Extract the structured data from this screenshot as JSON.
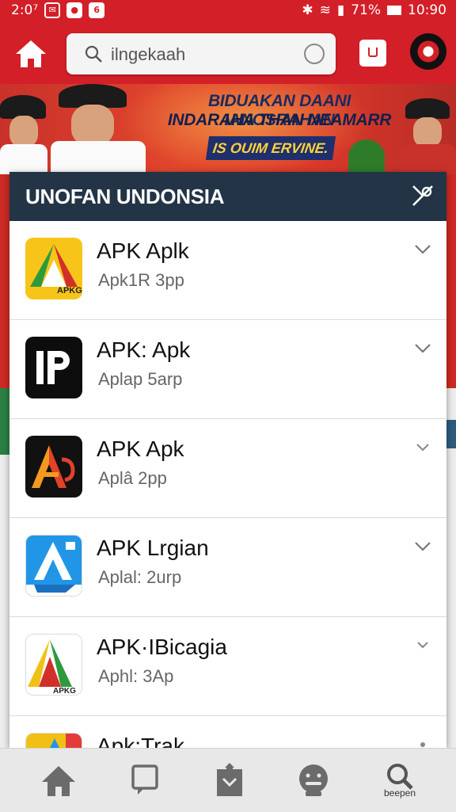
{
  "status_bar": {
    "time_left": "2:0⁷",
    "battery_percent": "71%",
    "time_right": "10:90",
    "accent_color": "#d31f28"
  },
  "app_bar": {
    "search_query": "ilngekaah",
    "home_icon": "home-icon",
    "bookmark_icon": "bookmark-icon",
    "avatar": "profile-avatar"
  },
  "banner": {
    "line1": "BIDUAKAN DAANI IANOSRAHAN",
    "line2": "INDARAHA THAN NEAMARR",
    "tag": "IS OUIM ERVINE."
  },
  "panel": {
    "title": "UNOFAN UNDONSIA",
    "header_color": "#223446",
    "items": [
      {
        "name": "APK Aplk",
        "sub": "Apk1R 3pp",
        "icon": "apk-triangle-green-yellow-icon"
      },
      {
        "name": "APK: Apk",
        "sub": "Aplap 5arp",
        "icon": "ip-black-icon"
      },
      {
        "name": "APK Apk",
        "sub": "Aplâ 2pp",
        "icon": "a-orange-black-icon"
      },
      {
        "name": "APK Lrgian",
        "sub": "Aplal: 2urp",
        "icon": "a-blue-icon"
      },
      {
        "name": "APK·IBicagia",
        "sub": "Aphl: 3Ap",
        "icon": "apkg-triangle-icon"
      },
      {
        "name": "Apk:Trak",
        "sub": "",
        "icon": "a-blue-red-icon"
      }
    ]
  },
  "bottom_nav": {
    "items": [
      "home-icon",
      "chat-icon",
      "download-icon",
      "more-icon",
      "search-icon"
    ],
    "search_label": "beepen"
  }
}
